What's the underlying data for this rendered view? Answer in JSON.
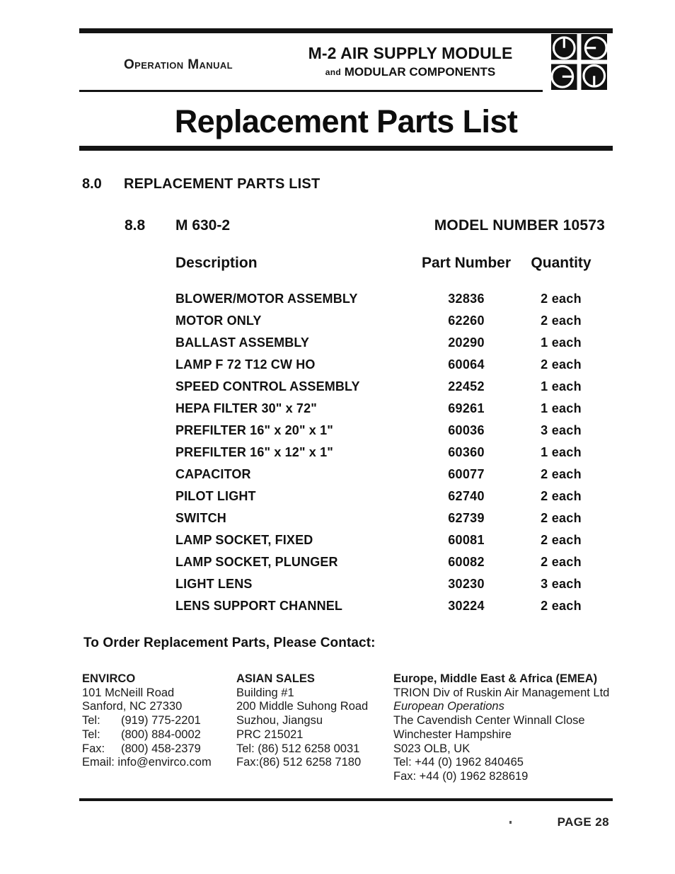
{
  "header": {
    "manual_label": "Operation Manual",
    "product_line1": "M-2 AIR SUPPLY MODULE",
    "product_and": "and",
    "product_line2": "MODULAR COMPONENTS",
    "logo_name": "envirco-square-logo"
  },
  "document": {
    "title": "Replacement Parts List",
    "section_number": "8.0",
    "section_title": "REPLACEMENT PARTS LIST",
    "subsection_number": "8.8",
    "subsection_title": "M 630-2",
    "model_number": "MODEL NUMBER 10573"
  },
  "table": {
    "headers": {
      "description": "Description",
      "part_number": "Part Number",
      "quantity": "Quantity"
    },
    "rows": [
      {
        "description": "BLOWER/MOTOR ASSEMBLY",
        "part_number": "32836",
        "quantity": "2 each"
      },
      {
        "description": "MOTOR ONLY",
        "part_number": "62260",
        "quantity": "2 each"
      },
      {
        "description": "BALLAST ASSEMBLY",
        "part_number": "20290",
        "quantity": "1 each"
      },
      {
        "description": "LAMP  F 72 T12 CW HO",
        "part_number": "60064",
        "quantity": "2 each"
      },
      {
        "description": "SPEED CONTROL ASSEMBLY",
        "part_number": "22452",
        "quantity": "1 each"
      },
      {
        "description": "HEPA FILTER 30\" x 72\"",
        "part_number": "69261",
        "quantity": "1 each"
      },
      {
        "description": "PREFILTER   16\" x 20\" x 1\"",
        "part_number": "60036",
        "quantity": "3 each"
      },
      {
        "description": "PREFILTER   16\" x 12\" x 1\"",
        "part_number": "60360",
        "quantity": "1 each"
      },
      {
        "description": "CAPACITOR",
        "part_number": "60077",
        "quantity": "2 each"
      },
      {
        "description": "PILOT LIGHT",
        "part_number": "62740",
        "quantity": "2 each"
      },
      {
        "description": "SWITCH",
        "part_number": "62739",
        "quantity": "2 each"
      },
      {
        "description": "LAMP SOCKET, FIXED",
        "part_number": "60081",
        "quantity": "2 each"
      },
      {
        "description": "LAMP SOCKET, PLUNGER",
        "part_number": "60082",
        "quantity": "2 each"
      },
      {
        "description": "LIGHT LENS",
        "part_number": "30230",
        "quantity": "3 each"
      },
      {
        "description": "LENS SUPPORT CHANNEL",
        "part_number": "30224",
        "quantity": "2 each"
      }
    ]
  },
  "contact": {
    "heading": "To Order Replacement Parts, Please Contact:",
    "columns": [
      {
        "name": "ENVIRCO",
        "lines": [
          {
            "text": "101 McNeill Road",
            "italic": false
          },
          {
            "text": "Sanford, NC 27330",
            "italic": false
          },
          {
            "label": "Tel:",
            "text": "(919) 775-2201",
            "italic": false
          },
          {
            "label": "Tel:",
            "text": "(800) 884-0002",
            "italic": false
          },
          {
            "label": "Fax:",
            "text": "(800) 458-2379",
            "italic": false
          },
          {
            "text": "Email: info@envirco.com",
            "italic": false
          }
        ]
      },
      {
        "name": "ASIAN SALES",
        "lines": [
          {
            "text": "Building #1",
            "italic": false
          },
          {
            "text": "200 Middle Suhong Road",
            "italic": false
          },
          {
            "text": "Suzhou, Jiangsu",
            "italic": false
          },
          {
            "text": "PRC 215021",
            "italic": false
          },
          {
            "text": "Tel: (86) 512 6258 0031",
            "italic": false
          },
          {
            "text": "Fax:(86) 512 6258 7180",
            "italic": false
          }
        ]
      },
      {
        "name": "Europe, Middle East & Africa (EMEA)",
        "lines": [
          {
            "text": "TRION Div of Ruskin Air Management Ltd",
            "italic": false
          },
          {
            "text": "European Operations",
            "italic": true
          },
          {
            "text": "The Cavendish Center Winnall Close",
            "italic": false
          },
          {
            "text": "Winchester Hampshire",
            "italic": false
          },
          {
            "text": "S023 OLB, UK",
            "italic": false
          },
          {
            "text": "Tel: +44 (0) 1962 840465",
            "italic": false
          },
          {
            "text": "Fax: +44 (0) 1962 828619",
            "italic": false
          }
        ]
      }
    ]
  },
  "footer": {
    "page_label": "PAGE 28"
  }
}
